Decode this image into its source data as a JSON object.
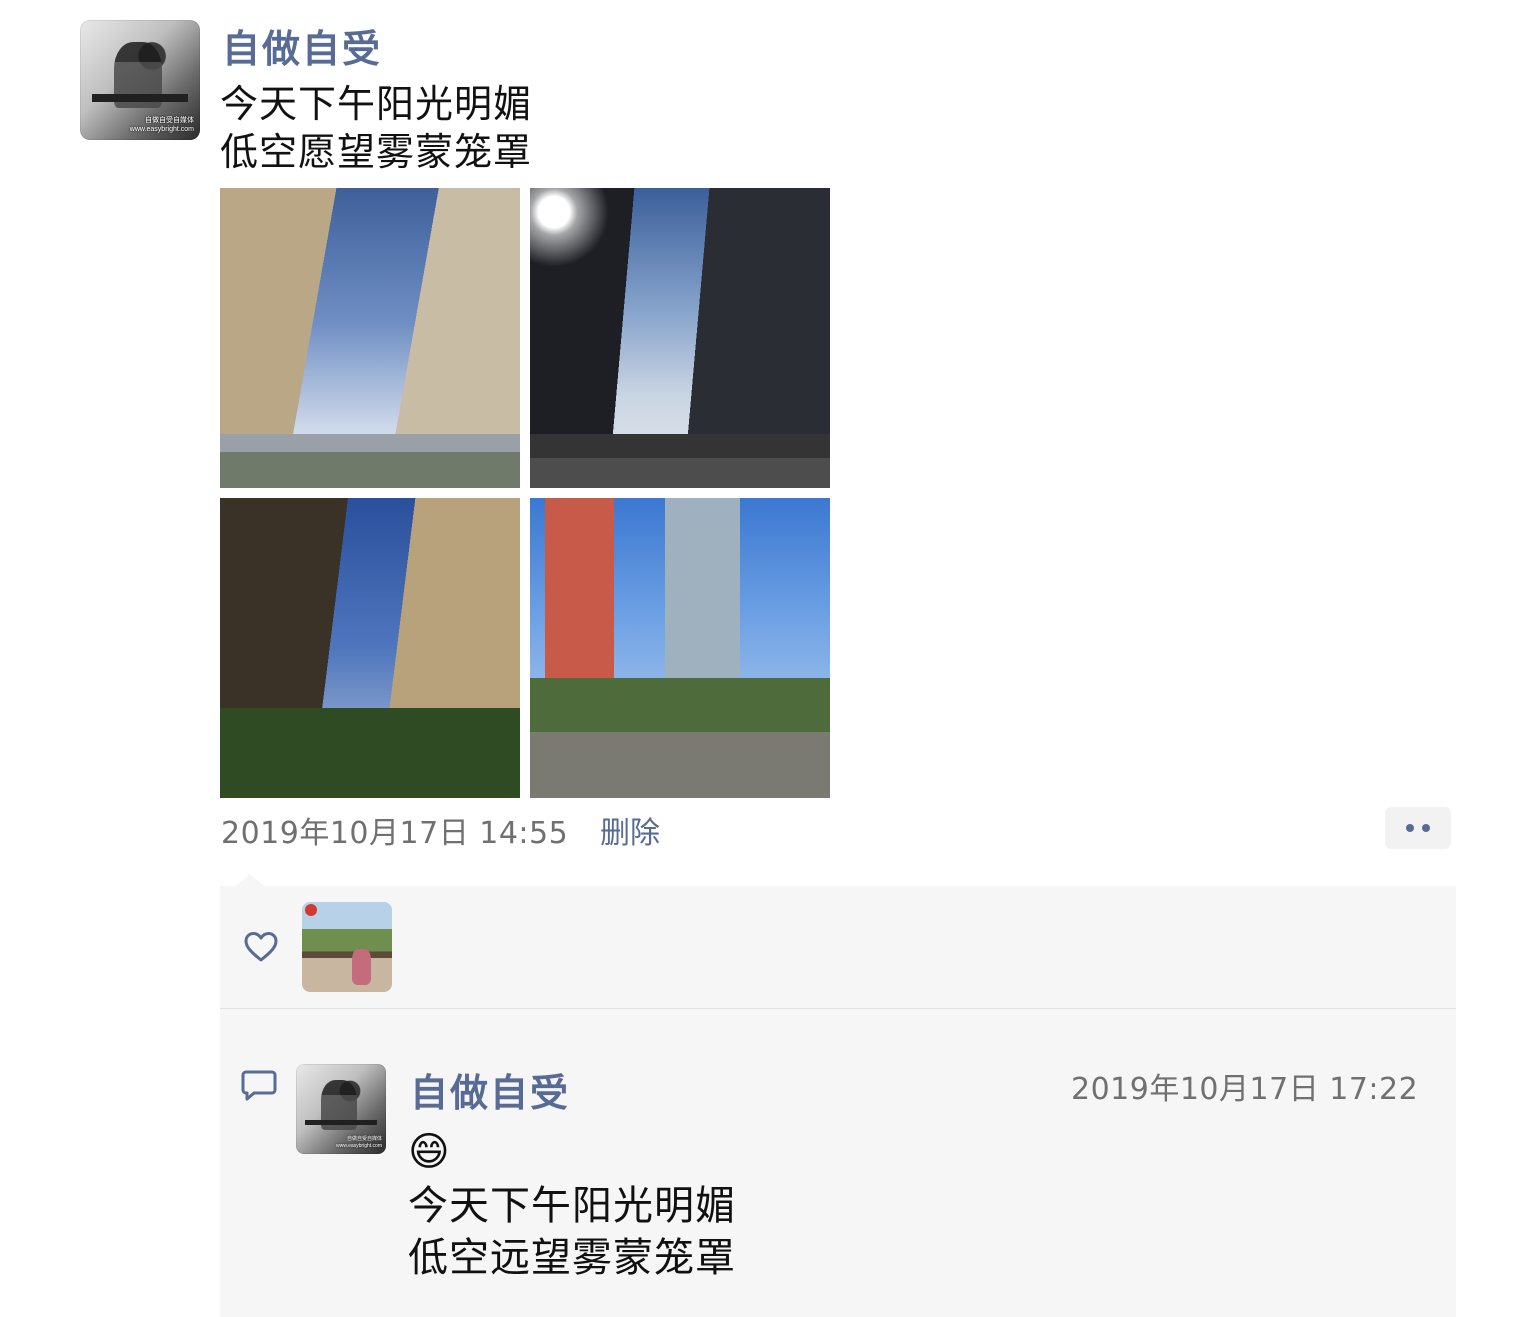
{
  "post": {
    "author": "自做自受",
    "avatar_watermark": [
      "自做自受自媒体",
      "www.easybright.com"
    ],
    "text_lines": [
      "今天下午阳光明媚",
      "低空愿望雾蒙笼罩"
    ],
    "photos": [
      {
        "name": "photo-1",
        "alt": "tall residential buildings, blue sky"
      },
      {
        "name": "photo-2",
        "alt": "backlit towers with sun"
      },
      {
        "name": "photo-3",
        "alt": "building canyon upward view"
      },
      {
        "name": "photo-4",
        "alt": "city skyline with greenery"
      }
    ],
    "timestamp": "2019年10月17日 14:55",
    "delete_label": "删除",
    "more_icon": "more-dots-icon"
  },
  "likes": {
    "icon": "heart-icon",
    "users": [
      {
        "name": "liker-1"
      }
    ]
  },
  "comments": [
    {
      "icon": "comment-bubble-icon",
      "author": "自做自受",
      "avatar_watermark": [
        "自做自受自媒体",
        "www.easybright.com"
      ],
      "time": "2019年10月17日 17:22",
      "emoji": "😄",
      "text_lines": [
        "今天下午阳光明媚",
        "低空远望雾蒙笼罩"
      ]
    }
  ],
  "colors": {
    "link": "#576b95",
    "meta": "#707070",
    "panel_bg": "#f6f6f6",
    "text": "#111111"
  }
}
